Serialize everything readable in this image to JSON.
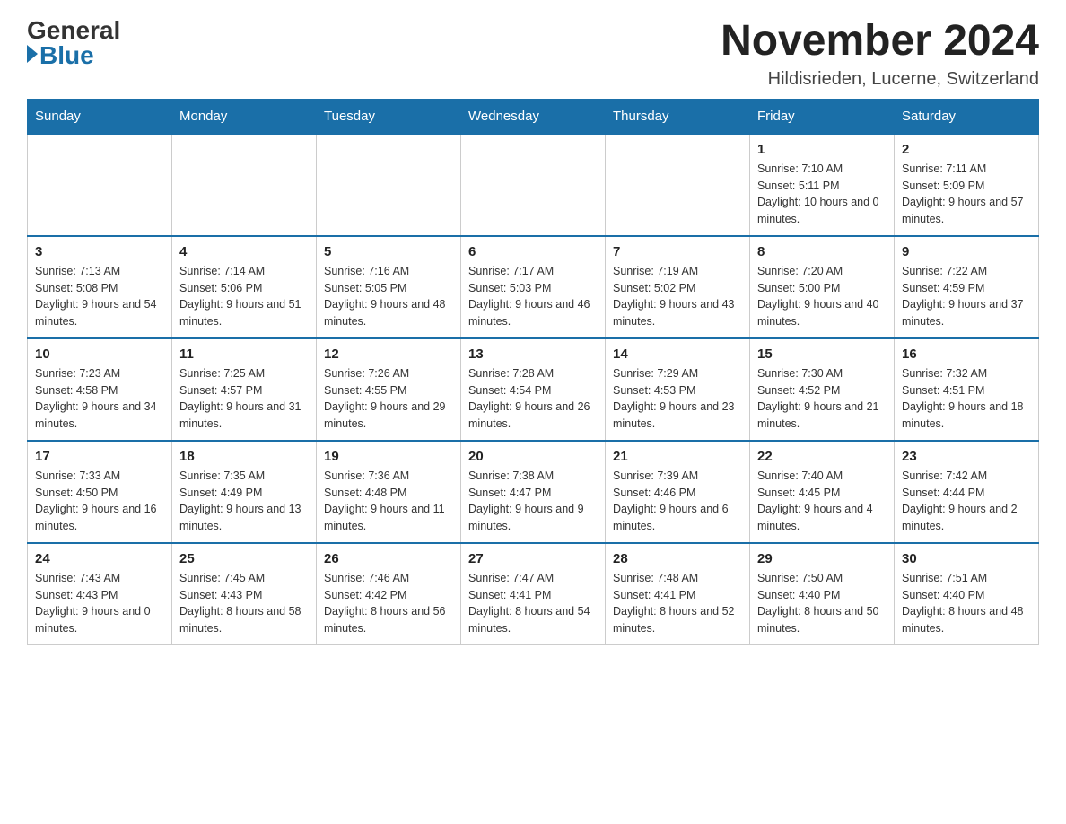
{
  "logo": {
    "general": "General",
    "blue": "Blue"
  },
  "header": {
    "month_title": "November 2024",
    "location": "Hildisrieden, Lucerne, Switzerland"
  },
  "days_of_week": [
    "Sunday",
    "Monday",
    "Tuesday",
    "Wednesday",
    "Thursday",
    "Friday",
    "Saturday"
  ],
  "weeks": [
    [
      {
        "day": "",
        "info": ""
      },
      {
        "day": "",
        "info": ""
      },
      {
        "day": "",
        "info": ""
      },
      {
        "day": "",
        "info": ""
      },
      {
        "day": "",
        "info": ""
      },
      {
        "day": "1",
        "info": "Sunrise: 7:10 AM\nSunset: 5:11 PM\nDaylight: 10 hours and 0 minutes."
      },
      {
        "day": "2",
        "info": "Sunrise: 7:11 AM\nSunset: 5:09 PM\nDaylight: 9 hours and 57 minutes."
      }
    ],
    [
      {
        "day": "3",
        "info": "Sunrise: 7:13 AM\nSunset: 5:08 PM\nDaylight: 9 hours and 54 minutes."
      },
      {
        "day": "4",
        "info": "Sunrise: 7:14 AM\nSunset: 5:06 PM\nDaylight: 9 hours and 51 minutes."
      },
      {
        "day": "5",
        "info": "Sunrise: 7:16 AM\nSunset: 5:05 PM\nDaylight: 9 hours and 48 minutes."
      },
      {
        "day": "6",
        "info": "Sunrise: 7:17 AM\nSunset: 5:03 PM\nDaylight: 9 hours and 46 minutes."
      },
      {
        "day": "7",
        "info": "Sunrise: 7:19 AM\nSunset: 5:02 PM\nDaylight: 9 hours and 43 minutes."
      },
      {
        "day": "8",
        "info": "Sunrise: 7:20 AM\nSunset: 5:00 PM\nDaylight: 9 hours and 40 minutes."
      },
      {
        "day": "9",
        "info": "Sunrise: 7:22 AM\nSunset: 4:59 PM\nDaylight: 9 hours and 37 minutes."
      }
    ],
    [
      {
        "day": "10",
        "info": "Sunrise: 7:23 AM\nSunset: 4:58 PM\nDaylight: 9 hours and 34 minutes."
      },
      {
        "day": "11",
        "info": "Sunrise: 7:25 AM\nSunset: 4:57 PM\nDaylight: 9 hours and 31 minutes."
      },
      {
        "day": "12",
        "info": "Sunrise: 7:26 AM\nSunset: 4:55 PM\nDaylight: 9 hours and 29 minutes."
      },
      {
        "day": "13",
        "info": "Sunrise: 7:28 AM\nSunset: 4:54 PM\nDaylight: 9 hours and 26 minutes."
      },
      {
        "day": "14",
        "info": "Sunrise: 7:29 AM\nSunset: 4:53 PM\nDaylight: 9 hours and 23 minutes."
      },
      {
        "day": "15",
        "info": "Sunrise: 7:30 AM\nSunset: 4:52 PM\nDaylight: 9 hours and 21 minutes."
      },
      {
        "day": "16",
        "info": "Sunrise: 7:32 AM\nSunset: 4:51 PM\nDaylight: 9 hours and 18 minutes."
      }
    ],
    [
      {
        "day": "17",
        "info": "Sunrise: 7:33 AM\nSunset: 4:50 PM\nDaylight: 9 hours and 16 minutes."
      },
      {
        "day": "18",
        "info": "Sunrise: 7:35 AM\nSunset: 4:49 PM\nDaylight: 9 hours and 13 minutes."
      },
      {
        "day": "19",
        "info": "Sunrise: 7:36 AM\nSunset: 4:48 PM\nDaylight: 9 hours and 11 minutes."
      },
      {
        "day": "20",
        "info": "Sunrise: 7:38 AM\nSunset: 4:47 PM\nDaylight: 9 hours and 9 minutes."
      },
      {
        "day": "21",
        "info": "Sunrise: 7:39 AM\nSunset: 4:46 PM\nDaylight: 9 hours and 6 minutes."
      },
      {
        "day": "22",
        "info": "Sunrise: 7:40 AM\nSunset: 4:45 PM\nDaylight: 9 hours and 4 minutes."
      },
      {
        "day": "23",
        "info": "Sunrise: 7:42 AM\nSunset: 4:44 PM\nDaylight: 9 hours and 2 minutes."
      }
    ],
    [
      {
        "day": "24",
        "info": "Sunrise: 7:43 AM\nSunset: 4:43 PM\nDaylight: 9 hours and 0 minutes."
      },
      {
        "day": "25",
        "info": "Sunrise: 7:45 AM\nSunset: 4:43 PM\nDaylight: 8 hours and 58 minutes."
      },
      {
        "day": "26",
        "info": "Sunrise: 7:46 AM\nSunset: 4:42 PM\nDaylight: 8 hours and 56 minutes."
      },
      {
        "day": "27",
        "info": "Sunrise: 7:47 AM\nSunset: 4:41 PM\nDaylight: 8 hours and 54 minutes."
      },
      {
        "day": "28",
        "info": "Sunrise: 7:48 AM\nSunset: 4:41 PM\nDaylight: 8 hours and 52 minutes."
      },
      {
        "day": "29",
        "info": "Sunrise: 7:50 AM\nSunset: 4:40 PM\nDaylight: 8 hours and 50 minutes."
      },
      {
        "day": "30",
        "info": "Sunrise: 7:51 AM\nSunset: 4:40 PM\nDaylight: 8 hours and 48 minutes."
      }
    ]
  ]
}
